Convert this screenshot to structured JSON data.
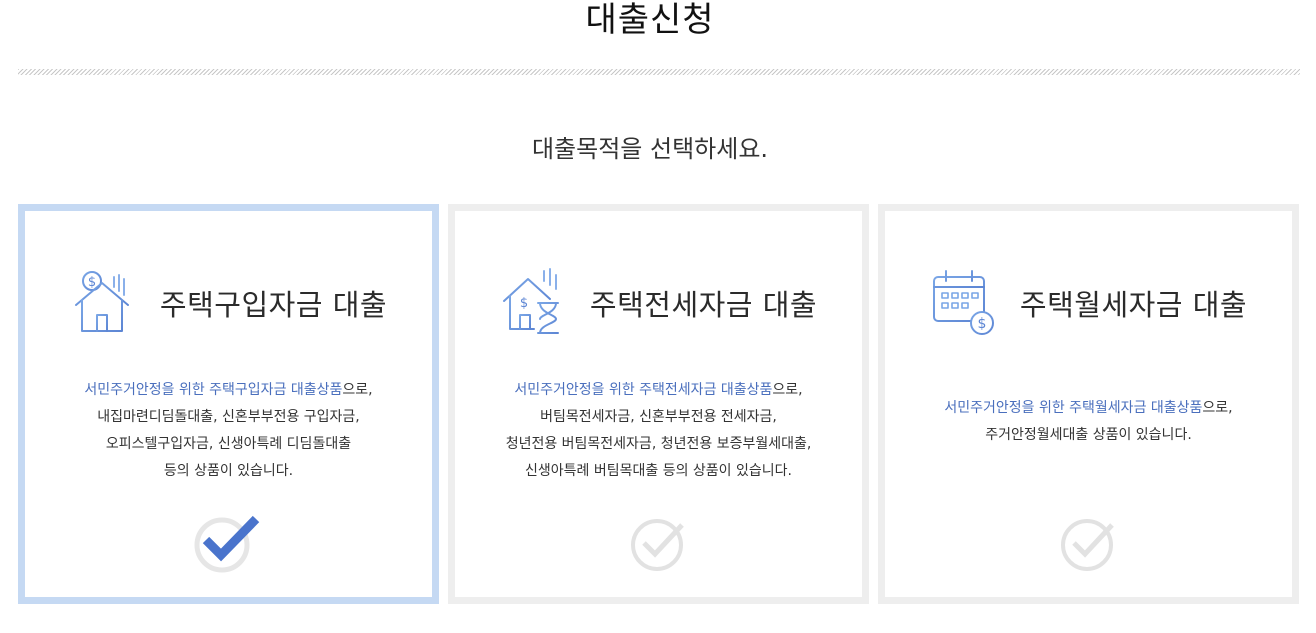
{
  "page": {
    "title": "대출신청",
    "subtitle": "대출목적을 선택하세요."
  },
  "cards": [
    {
      "title": "주택구입자금 대출",
      "icon": "house-dollar-icon",
      "selected": true,
      "desc_highlight": "서민주거안정을 위한 주택구입자금 대출상품",
      "desc_suffix": "으로,",
      "lines": [
        "내집마련디딤돌대출, 신혼부부전용 구입자금,",
        "오피스텔구입자금, 신생아특례 디딤돌대출",
        "등의 상품이 있습니다."
      ]
    },
    {
      "title": "주택전세자금 대출",
      "icon": "house-hourglass-icon",
      "selected": false,
      "desc_highlight": "서민주거안정을 위한 주택전세자금 대출상품",
      "desc_suffix": "으로,",
      "lines": [
        "버팀목전세자금, 신혼부부전용 전세자금,",
        "청년전용 버팀목전세자금, 청년전용 보증부월세대출,",
        "신생아특례 버팀목대출 등의 상품이 있습니다."
      ]
    },
    {
      "title": "주택월세자금 대출",
      "icon": "calendar-dollar-icon",
      "selected": false,
      "desc_highlight": "서민주거안정을 위한 주택월세자금 대출상품",
      "desc_suffix": "으로,",
      "lines": [
        "주거안정월세대출 상품이 있습니다."
      ]
    }
  ],
  "colors": {
    "accent": "#4a6fbd",
    "selected_border": "#c5d9f3",
    "card_border": "#eeeeee",
    "check_active": "#4a74cc",
    "check_inactive": "#e2e2e2"
  }
}
